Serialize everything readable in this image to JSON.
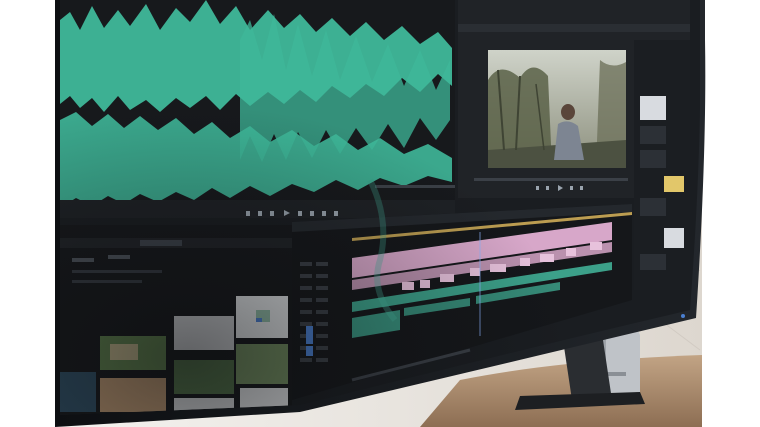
{
  "photo": {
    "subject": "curved-monitor-running-video-editing-software",
    "workspace_tabs": [
      "",
      "",
      "",
      "",
      ""
    ],
    "timecode_source": "",
    "timecode_program": "",
    "sequence_name": "",
    "colors": {
      "waveform": "#3fb89a",
      "panel_bg": "#1f2226",
      "timeline_clip_pink": "#d7a7c9",
      "timeline_clip_green": "#3ca089",
      "playhead_blue": "#4a7fd0",
      "wall": "#e6e2dd",
      "desk": "#a8896d"
    }
  }
}
